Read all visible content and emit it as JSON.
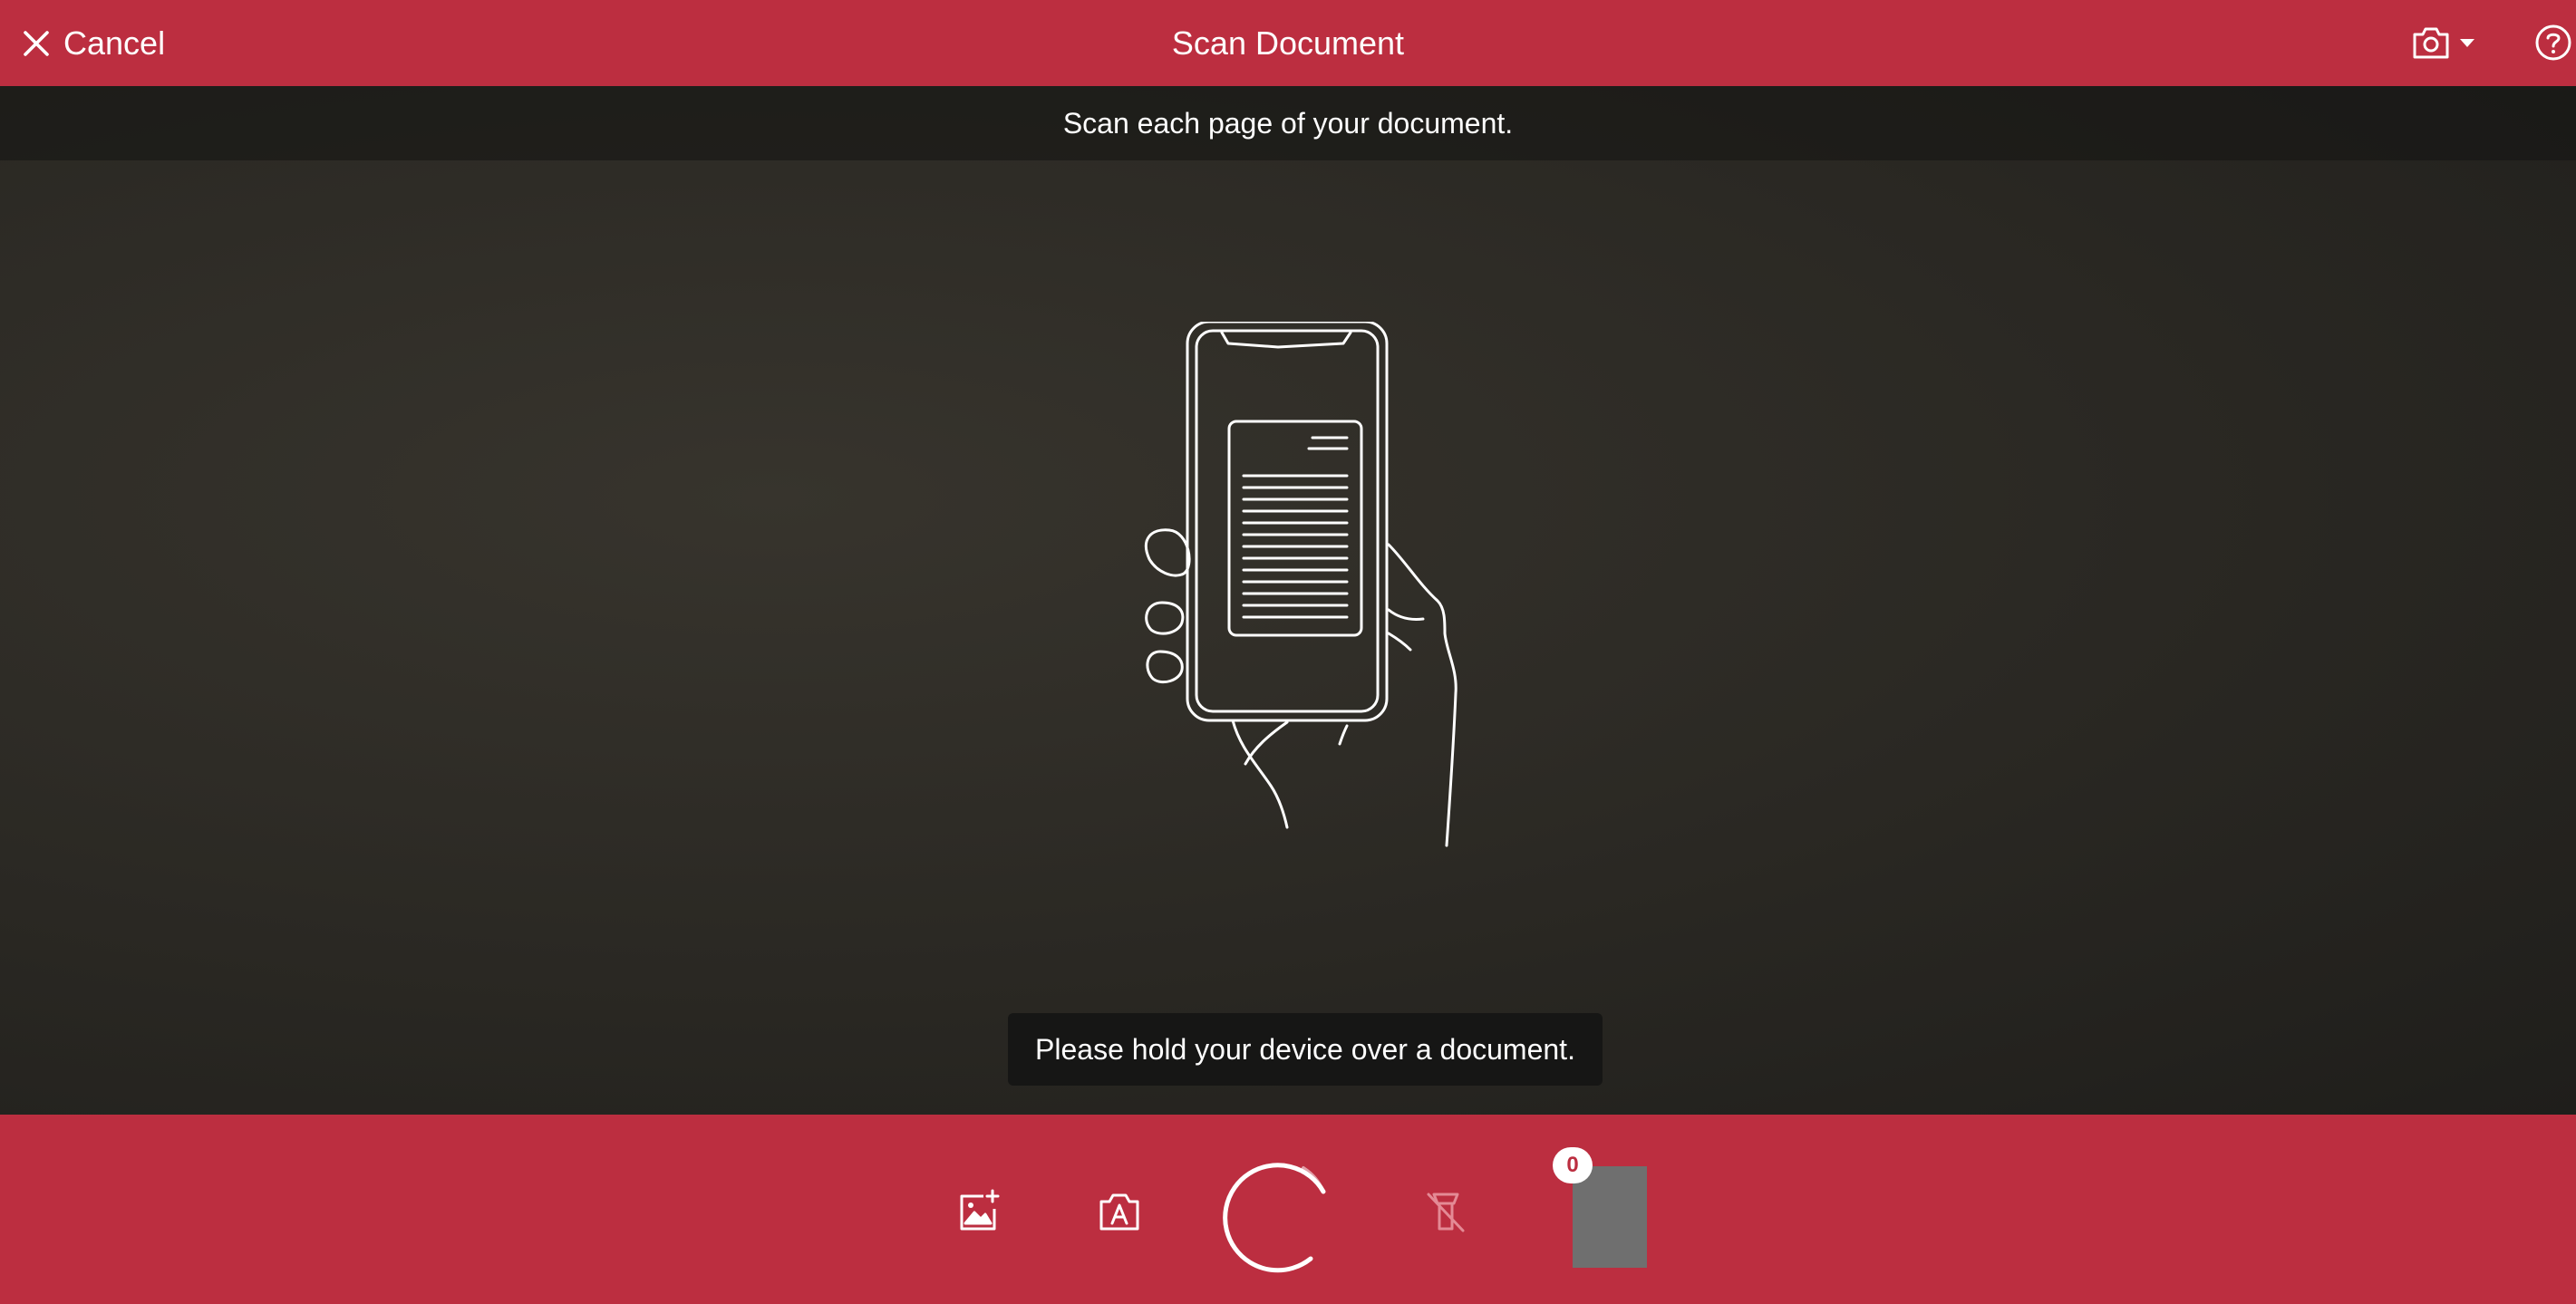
{
  "header": {
    "cancel_label": "Cancel",
    "title": "Scan Document",
    "icons": {
      "cancel": "close-icon",
      "camera": "camera-icon",
      "camera_menu": "caret-down-icon",
      "help": "help-icon"
    }
  },
  "viewport": {
    "instruction": "Scan each page of your document.",
    "illustration": "hand-holding-phone-illustration",
    "toast": "Please hold your device over a document."
  },
  "toolbar": {
    "icons": {
      "gallery": "add-image-icon",
      "ocr": "text-recognition-camera-icon",
      "shutter": "capture-spinner-icon",
      "flash": "flash-off-icon"
    },
    "page_count": "0"
  },
  "colors": {
    "brand": "#bc2e40",
    "viewport_bg": "#2c2a25",
    "toast_bg": "#161615",
    "thumbnail": "#6f6f6f"
  }
}
